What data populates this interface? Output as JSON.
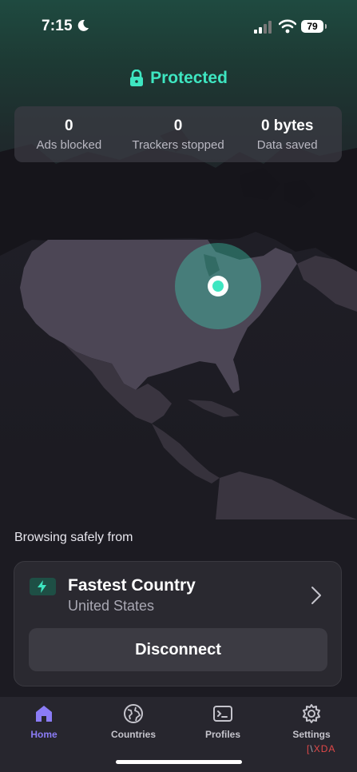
{
  "status_bar": {
    "time": "7:15",
    "battery": "79"
  },
  "protection": {
    "status": "Protected",
    "accent": "#3ee6c1"
  },
  "stats": [
    {
      "value": "0",
      "label": "Ads blocked"
    },
    {
      "value": "0",
      "label": "Trackers stopped"
    },
    {
      "value": "0 bytes",
      "label": "Data saved"
    }
  ],
  "connection": {
    "heading": "Browsing safely from",
    "server_name": "Fastest Country",
    "server_country": "United States",
    "disconnect_label": "Disconnect"
  },
  "tabs": [
    {
      "label": "Home",
      "icon": "home-icon",
      "active": true
    },
    {
      "label": "Countries",
      "icon": "globe-icon",
      "active": false
    },
    {
      "label": "Profiles",
      "icon": "terminal-icon",
      "active": false
    },
    {
      "label": "Settings",
      "icon": "gear-icon",
      "active": false
    }
  ],
  "watermark": {
    "brand": "XDA"
  },
  "colors": {
    "accent": "#3ee6c1",
    "tab_active": "#8b7cf6",
    "background": "#1c1b22"
  }
}
